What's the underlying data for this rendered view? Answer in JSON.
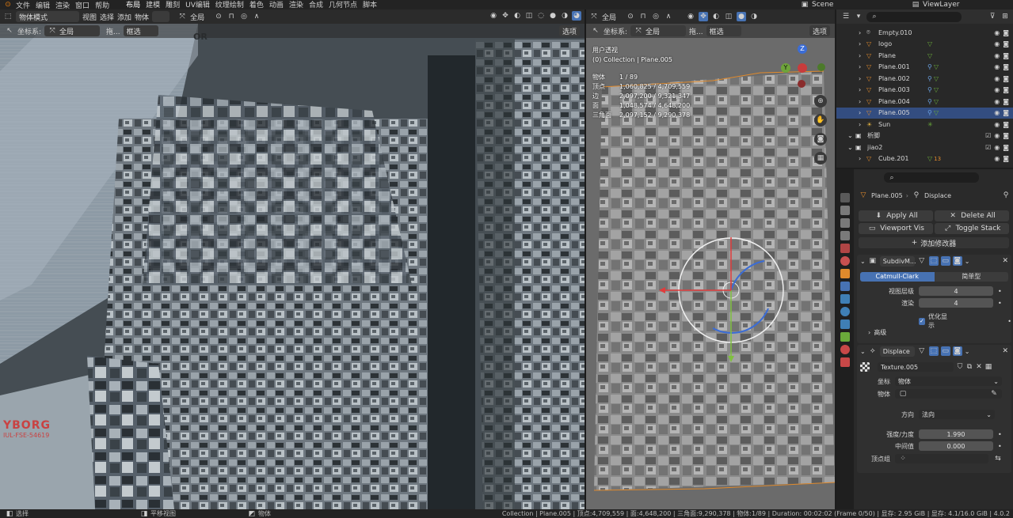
{
  "menubar": {
    "items": [
      "文件",
      "编辑",
      "渲染",
      "窗口",
      "帮助"
    ],
    "workspaces": [
      "布局",
      "建模",
      "雕刻",
      "UV编辑",
      "纹理绘制",
      "着色",
      "动画",
      "渲染",
      "合成",
      "几何节点",
      "脚本"
    ],
    "scene": "Scene",
    "view_layer": "ViewLayer"
  },
  "viewport_left": {
    "mode": "物体模式",
    "menus": [
      "视图",
      "选择",
      "添加",
      "物体"
    ],
    "orientation": "全局",
    "coord_label": "坐标系:",
    "coord_value": "全局",
    "drag_label": "拖...",
    "drag_value": "框选",
    "options": "选项",
    "overlay_texts": [
      "OR",
      "YBORG",
      "IUL-FSE-54619"
    ]
  },
  "viewport_right": {
    "orientation": "全局",
    "coord_label": "坐标系:",
    "coord_value": "全局",
    "drag_label": "拖...",
    "drag_value": "框选",
    "options": "选项",
    "view_name": "用户透视",
    "collection": "(0) Collection | Plane.005",
    "stats": [
      {
        "label": "物体",
        "value": "1 / 89"
      },
      {
        "label": "顶点",
        "value": "1,060,825 / 4,709,559"
      },
      {
        "label": "边",
        "value": "2,097,200 / 9,321,347"
      },
      {
        "label": "面",
        "value": "1,048,574 / 4,648,200"
      },
      {
        "label": "三角面",
        "value": "2,097,152 / 9,290,378"
      }
    ],
    "axes": {
      "z": "Z",
      "y": "Y"
    }
  },
  "outliner": {
    "search_placeholder": "",
    "items": [
      {
        "name": "Empty.010",
        "depth": 2
      },
      {
        "name": "logo",
        "depth": 2
      },
      {
        "name": "Plane",
        "depth": 2
      },
      {
        "name": "Plane.001",
        "depth": 2
      },
      {
        "name": "Plane.002",
        "depth": 2
      },
      {
        "name": "Plane.003",
        "depth": 2
      },
      {
        "name": "Plane.004",
        "depth": 2
      },
      {
        "name": "Plane.005",
        "depth": 2,
        "selected": true
      },
      {
        "name": "Sun",
        "depth": 2
      },
      {
        "name": "析脚",
        "depth": 1
      },
      {
        "name": "jiao2",
        "depth": 1
      },
      {
        "name": "Cube.201",
        "depth": 2,
        "badge": "13"
      }
    ]
  },
  "properties": {
    "object": "Plane.005",
    "modifier_label": "Displace",
    "apply_all": "Apply All",
    "delete_all": "Delete All",
    "viewport_vis": "Viewport Vis",
    "toggle_stack": "Toggle Stack",
    "add_modifier": "添加修改器",
    "subdiv": {
      "name": "SubdivM...",
      "tab_catmull": "Catmull-Clark",
      "tab_simple": "简单型",
      "levels_label": "视图层级",
      "levels_value": "4",
      "render_label": "渲染",
      "render_value": "4",
      "optimal_label": "优化显示",
      "advanced": "高级"
    },
    "displace": {
      "name": "Displace",
      "texture": "Texture.005",
      "coords_label": "坐标",
      "coords_value": "物体",
      "object_label": "物体",
      "direction_label": "方向",
      "direction_value": "法向",
      "strength_label": "强度/力度",
      "strength_value": "1.990",
      "midlevel_label": "中间值",
      "midlevel_value": "0.000",
      "vgroup_label": "顶点组"
    }
  },
  "statusbar": {
    "left1": "选择",
    "left2": "平移视图",
    "left3": "物体",
    "right": "Collection | Plane.005 | 顶点:4,709,559 | 面:4,648,200 | 三角面:9,290,378 | 物体:1/89 | Duration: 00:02:02 (Frame 0/50) | 显存: 2.95 GiB | 显存: 4.1/16.0 GiB | 4.0.2"
  },
  "colors": {
    "accent": "#4772b3",
    "selected_row": "#334d80",
    "orange": "#e08a2c",
    "green": "#7fbf3f"
  }
}
